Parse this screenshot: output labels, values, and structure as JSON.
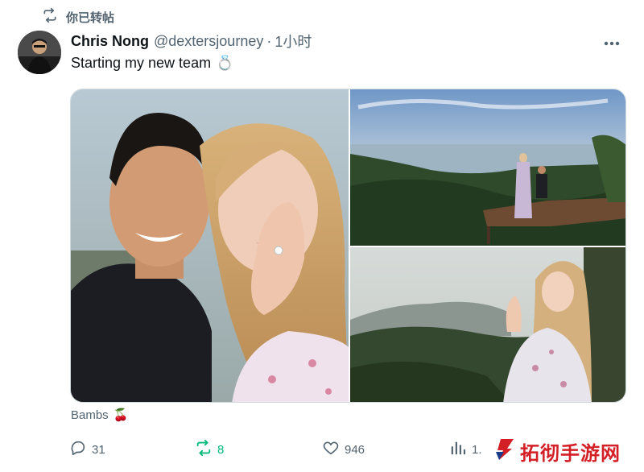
{
  "retweet_banner": {
    "label": "你已转帖",
    "icon": "retweet-icon"
  },
  "tweet": {
    "author_name": "Chris Nong",
    "handle": "@dextersjourney",
    "separator": "·",
    "time": "1小时",
    "text": "Starting my new team",
    "text_emoji": "💍",
    "caption": "Bambs",
    "caption_emoji": "🍒"
  },
  "actions": {
    "reply_count": "31",
    "retweet_count": "8",
    "like_count": "946",
    "views_count": "1."
  },
  "colors": {
    "text_primary": "#0f1419",
    "text_secondary": "#536471",
    "retweet_active": "#00ba7c",
    "watermark_red": "#d31f26",
    "watermark_blue": "#1b3a8c"
  },
  "watermark": {
    "text": "拓彻手游网"
  }
}
